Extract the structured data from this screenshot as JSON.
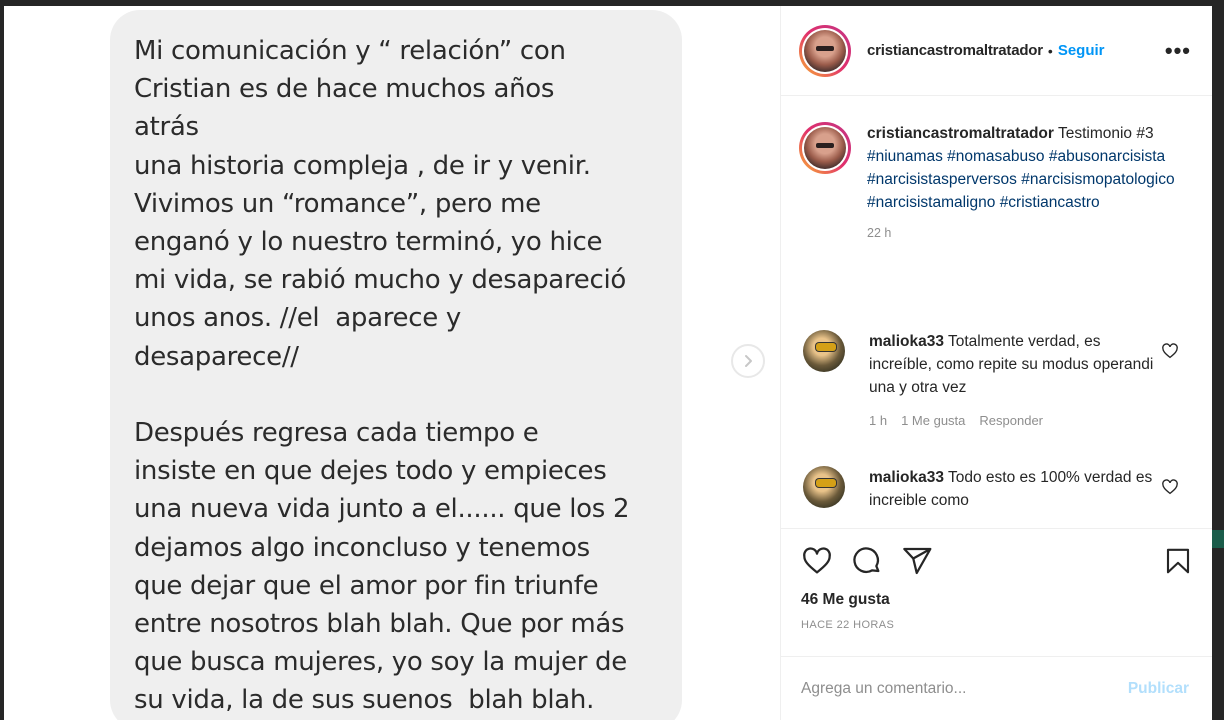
{
  "message": {
    "text": "Mi comunicación y “ relación” con\nCristian es de hace muchos años\natrás\nuna historia compleja , de ir y venir.\nVivimos un “romance”, pero me\nenganó y lo nuestro terminó, yo hice\nmi vida, se rabió mucho y desapareció\nunos anos. //el  aparece y\ndesaparece//\n\nDespués regresa cada tiempo e\ninsiste en que dejes todo y empieces\nuna nueva vida junto a el...... que los 2\ndejamos algo inconcluso y tenemos\nque dejar que el amor por fin triunfe\nentre nosotros blah blah. Que por más\nque busca mujeres, yo soy la mujer de\nsu vida, la de sus suenos  blah blah."
  },
  "header": {
    "username": "cristiancastromaltratador",
    "separator": "•",
    "follow_label": "Seguir",
    "more_label": "•••"
  },
  "caption": {
    "username": "cristiancastromaltratador",
    "text": "Testimonio #3",
    "hashtags": [
      "#niunamas",
      "#nomasabuso",
      "#abusonarcisista",
      "#narcisistasperversos",
      "#narcisismopatologico",
      "#narcisistamaligno",
      "#cristiancastro"
    ],
    "time": "22 h"
  },
  "comments": [
    {
      "username": "malioka33",
      "text": "Totalmente verdad, es increíble, como repite su modus operandi una y otra vez",
      "time": "1 h",
      "likes": "1 Me gusta",
      "reply": "Responder"
    },
    {
      "username": "malioka33",
      "text": "Todo esto es 100% verdad es increible como"
    }
  ],
  "actions": {
    "likes": "46 Me gusta",
    "posted": "HACE 22 HORAS"
  },
  "comment_bar": {
    "placeholder": "Agrega un comentario...",
    "publish_label": "Publicar"
  },
  "colors": {
    "accent": "#0095f6",
    "hashtag": "#00376b",
    "muted": "#8e8e8e",
    "bubble": "#efefef"
  }
}
